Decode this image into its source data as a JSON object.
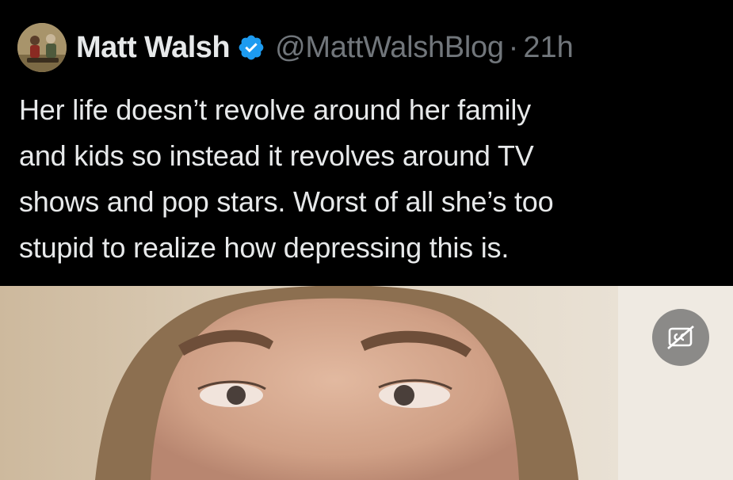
{
  "tweet": {
    "author": {
      "display_name": "Matt Walsh",
      "handle": "@MattWalshBlog",
      "avatar_icon": "profile-photo",
      "verified_icon": "verified-badge-icon",
      "verified_color": "#1d9bf0"
    },
    "separator": "·",
    "timestamp": "21h",
    "text": "Her life doesn’t revolve around her family\nand kids so instead it revolves around TV\nshows and pop stars. Worst of all she’s too\nstupid to realize how depressing this is.",
    "media": {
      "type": "video",
      "captions_icon": "captions-off-icon"
    }
  },
  "colors": {
    "background": "#000000",
    "primary_text": "#e7e9ea",
    "secondary_text": "#71767b",
    "accent": "#1d9bf0"
  }
}
